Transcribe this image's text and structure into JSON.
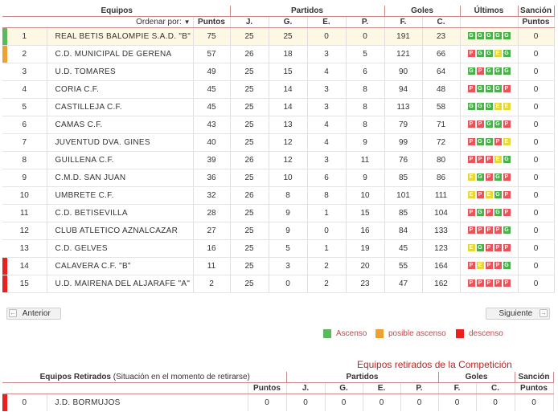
{
  "colors": {
    "ascenso": "#5cb85c",
    "posible_ascenso": "#f0a030",
    "descenso": "#e82020",
    "header_red": "#b52a2a",
    "team_green": "#2a8a32"
  },
  "headers": {
    "equipos": "Equipos",
    "partidos": "Partidos",
    "goles": "Goles",
    "ultimos": "Últimos",
    "sancion": "Sanción",
    "ordenar_por": "Ordenar por:",
    "sort_arrow_icon": "down-triangle",
    "puntos": "Puntos",
    "j": "J.",
    "g": "G.",
    "e": "E.",
    "p": "P.",
    "f": "F.",
    "c": "C."
  },
  "standings": [
    {
      "pos": "1",
      "team": "REAL BETIS BALOMPIE S.A.D. \"B\"",
      "pts": "75",
      "j": "25",
      "g": "25",
      "e": "0",
      "p": "0",
      "f": "191",
      "c": "23",
      "last": [
        "G",
        "G",
        "G",
        "G",
        "G"
      ],
      "sancion": "0",
      "zone": "ascenso"
    },
    {
      "pos": "2",
      "team": "C.D. MUNICIPAL DE GERENA",
      "pts": "57",
      "j": "26",
      "g": "18",
      "e": "3",
      "p": "5",
      "f": "121",
      "c": "66",
      "last": [
        "P",
        "G",
        "G",
        "E",
        "G"
      ],
      "sancion": "0",
      "zone": "posible_ascenso"
    },
    {
      "pos": "3",
      "team": "U.D. TOMARES",
      "pts": "49",
      "j": "25",
      "g": "15",
      "e": "4",
      "p": "6",
      "f": "90",
      "c": "64",
      "last": [
        "G",
        "P",
        "G",
        "G",
        "G"
      ],
      "sancion": "0",
      "zone": ""
    },
    {
      "pos": "4",
      "team": "CORIA C.F.",
      "pts": "45",
      "j": "25",
      "g": "14",
      "e": "3",
      "p": "8",
      "f": "94",
      "c": "48",
      "last": [
        "P",
        "G",
        "G",
        "G",
        "P"
      ],
      "sancion": "0",
      "zone": ""
    },
    {
      "pos": "5",
      "team": "CASTILLEJA C.F.",
      "pts": "45",
      "j": "25",
      "g": "14",
      "e": "3",
      "p": "8",
      "f": "113",
      "c": "58",
      "last": [
        "G",
        "G",
        "G",
        "E",
        "E"
      ],
      "sancion": "0",
      "zone": ""
    },
    {
      "pos": "6",
      "team": "CAMAS C.F.",
      "pts": "43",
      "j": "25",
      "g": "13",
      "e": "4",
      "p": "8",
      "f": "79",
      "c": "71",
      "last": [
        "P",
        "P",
        "G",
        "G",
        "P"
      ],
      "sancion": "0",
      "zone": ""
    },
    {
      "pos": "7",
      "team": "JUVENTUD DVA. GINES",
      "pts": "40",
      "j": "25",
      "g": "12",
      "e": "4",
      "p": "9",
      "f": "99",
      "c": "72",
      "last": [
        "P",
        "G",
        "G",
        "P",
        "E"
      ],
      "sancion": "0",
      "zone": ""
    },
    {
      "pos": "8",
      "team": "GUILLENA C.F.",
      "pts": "39",
      "j": "26",
      "g": "12",
      "e": "3",
      "p": "11",
      "f": "76",
      "c": "80",
      "last": [
        "P",
        "P",
        "P",
        "E",
        "G"
      ],
      "sancion": "0",
      "zone": ""
    },
    {
      "pos": "9",
      "team": "C.M.D. SAN JUAN",
      "pts": "36",
      "j": "25",
      "g": "10",
      "e": "6",
      "p": "9",
      "f": "85",
      "c": "86",
      "last": [
        "E",
        "G",
        "P",
        "G",
        "P"
      ],
      "sancion": "0",
      "zone": ""
    },
    {
      "pos": "10",
      "team": "UMBRETE C.F.",
      "pts": "32",
      "j": "26",
      "g": "8",
      "e": "8",
      "p": "10",
      "f": "101",
      "c": "111",
      "last": [
        "E",
        "P",
        "E",
        "G",
        "P"
      ],
      "sancion": "0",
      "zone": ""
    },
    {
      "pos": "11",
      "team": "C.D. BETISEVILLA",
      "pts": "28",
      "j": "25",
      "g": "9",
      "e": "1",
      "p": "15",
      "f": "85",
      "c": "104",
      "last": [
        "P",
        "G",
        "P",
        "G",
        "P"
      ],
      "sancion": "0",
      "zone": ""
    },
    {
      "pos": "12",
      "team": "CLUB ATLETICO AZNALCAZAR",
      "pts": "27",
      "j": "25",
      "g": "9",
      "e": "0",
      "p": "16",
      "f": "84",
      "c": "133",
      "last": [
        "P",
        "P",
        "P",
        "P",
        "G"
      ],
      "sancion": "0",
      "zone": ""
    },
    {
      "pos": "13",
      "team": "C.D. GELVES",
      "pts": "16",
      "j": "25",
      "g": "5",
      "e": "1",
      "p": "19",
      "f": "45",
      "c": "123",
      "last": [
        "E",
        "G",
        "P",
        "P",
        "P"
      ],
      "sancion": "0",
      "zone": ""
    },
    {
      "pos": "14",
      "team": "CALAVERA C.F. \"B\"",
      "pts": "11",
      "j": "25",
      "g": "3",
      "e": "2",
      "p": "20",
      "f": "55",
      "c": "164",
      "last": [
        "P",
        "E",
        "P",
        "P",
        "G"
      ],
      "sancion": "0",
      "zone": "descenso"
    },
    {
      "pos": "15",
      "team": "U.D. MAIRENA DEL ALJARAFE \"A\"",
      "pts": "2",
      "j": "25",
      "g": "0",
      "e": "2",
      "p": "23",
      "f": "47",
      "c": "162",
      "last": [
        "P",
        "P",
        "P",
        "P",
        "P"
      ],
      "sancion": "0",
      "zone": "descenso"
    }
  ],
  "nav": {
    "prev_label": "Anterior",
    "next_label": "Siguiente",
    "prev_icon": "arrow-left-icon",
    "next_icon": "arrow-right-icon"
  },
  "legend": {
    "ascenso": "Ascenso",
    "posible_ascenso": "posible ascenso",
    "descenso": "descenso"
  },
  "retired": {
    "title": "Equipos retirados de la Competición",
    "header_label": "Equipos Retirados",
    "header_note": "(Situación en el momento de retirarse)",
    "rows": [
      {
        "pos": "0",
        "team": "J.D. BORMUJOS",
        "pts": "0",
        "j": "0",
        "g": "0",
        "e": "0",
        "p": "0",
        "f": "0",
        "c": "0",
        "sancion": "0",
        "zone": "descenso"
      }
    ]
  }
}
